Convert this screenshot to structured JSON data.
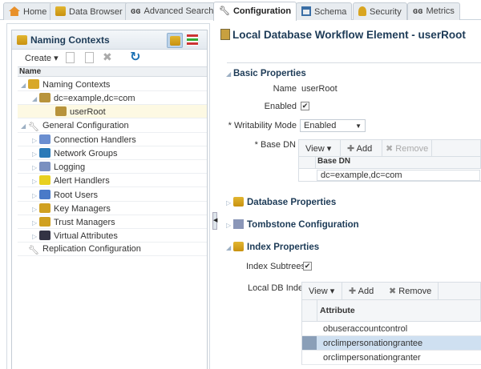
{
  "tabs": [
    {
      "label": "Home",
      "icon": "home-icon"
    },
    {
      "label": "Data Browser",
      "icon": "tree-icon"
    },
    {
      "label": "Advanced Search",
      "icon": "glasses-icon"
    },
    {
      "label": "Configuration",
      "icon": "wrench-icon",
      "active": true
    },
    {
      "label": "Schema",
      "icon": "schema-icon"
    },
    {
      "label": "Security",
      "icon": "security-icon"
    },
    {
      "label": "Metrics",
      "icon": "glasses-icon"
    }
  ],
  "left": {
    "title": "Naming Contexts",
    "create_label": "Create",
    "column": "Name",
    "tree": [
      {
        "label": "Naming Contexts",
        "level": 0,
        "expanded": true
      },
      {
        "label": "dc=example,dc=com",
        "level": 1,
        "expanded": true
      },
      {
        "label": "userRoot",
        "level": 2,
        "selected": true
      },
      {
        "label": "General Configuration",
        "level": 0,
        "expanded": true
      },
      {
        "label": "Connection Handlers",
        "level": 1
      },
      {
        "label": "Network Groups",
        "level": 1
      },
      {
        "label": "Logging",
        "level": 1
      },
      {
        "label": "Alert Handlers",
        "level": 1
      },
      {
        "label": "Root Users",
        "level": 1
      },
      {
        "label": "Key Managers",
        "level": 1
      },
      {
        "label": "Trust Managers",
        "level": 1
      },
      {
        "label": "Virtual Attributes",
        "level": 1
      },
      {
        "label": "Replication Configuration",
        "level": 0
      }
    ]
  },
  "main": {
    "title": "Local Database Workflow Element - userRoot",
    "basic": {
      "title": "Basic Properties",
      "name_label": "Name",
      "name_value": "userRoot",
      "enabled_label": "Enabled",
      "writability_label": "* Writability Mode",
      "writability_value": "Enabled",
      "basedn_label": "* Base DN",
      "view": "View",
      "add": "Add",
      "remove": "Remove",
      "column": "Base DN",
      "rows": [
        "dc=example,dc=com"
      ]
    },
    "database_title": "Database Properties",
    "tombstone_title": "Tombstone Configuration",
    "index": {
      "title": "Index Properties",
      "subtrees_label": "Index Subtrees",
      "localdb_label": "Local DB Index",
      "view": "View",
      "add": "Add",
      "remove": "Remove",
      "column": "Attribute",
      "rows": [
        "obuseraccountcontrol",
        "orclimpersonationgrantee",
        "orclimpersonationgranter"
      ]
    }
  }
}
